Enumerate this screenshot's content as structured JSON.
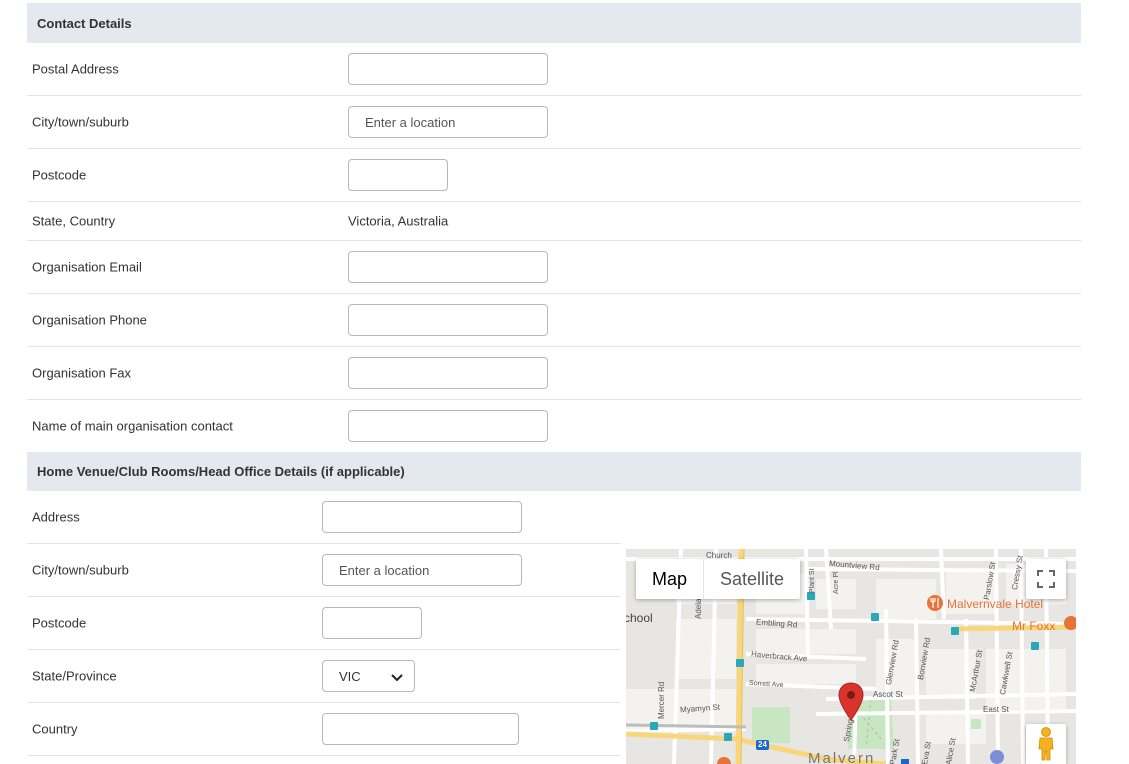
{
  "contact_section": {
    "title": "Contact Details",
    "postal_address_label": "Postal Address",
    "postal_address_value": "",
    "city_label": "City/town/suburb",
    "city_placeholder": "Enter a location",
    "postcode_label": "Postcode",
    "postcode_value": "",
    "state_country_label": "State, Country",
    "state_country_value": "Victoria, Australia",
    "email_label": "Organisation Email",
    "email_value": "",
    "phone_label": "Organisation Phone",
    "phone_value": "",
    "fax_label": "Organisation Fax",
    "fax_value": "",
    "main_contact_label": "Name of main organisation contact",
    "main_contact_value": ""
  },
  "venue_section": {
    "title": "Home Venue/Club Rooms/Head Office Details (if applicable)",
    "address_label": "Address",
    "address_value": "",
    "city_label": "City/town/suburb",
    "city_placeholder": "Enter a location",
    "postcode_label": "Postcode",
    "postcode_value": "",
    "state_label": "State/Province",
    "state_selected": "VIC",
    "country_label": "Country",
    "country_value": ""
  },
  "map": {
    "type_map_label": "Map",
    "type_satellite_label": "Satellite",
    "icons": [
      "fullscreen-icon",
      "pegman-icon",
      "location-pin-icon",
      "restaurant-icon",
      "bus-stop-icon"
    ],
    "pin_color": "#d9342b",
    "poi_color": "#e8733a",
    "labels": {
      "mountview_rd": "Mountview Rd",
      "embling_rd": "Embling Rd",
      "haverbrack_ave": "Haverbrack Ave",
      "sorrett_ave": "Sorrett Ave",
      "myamyn_st": "Myamyn St",
      "ascot_st": "Ascot St",
      "east_st": "East St",
      "adelaide_st": "Adelaide St",
      "mercer_rd": "Mercer Rd",
      "glenview_rd": "Glenview Rd",
      "bonview_rd": "Bonview Rd",
      "mcarthur_st": "McArthur St",
      "cawkwell_st": "Cawkwell St",
      "parslow_st": "Parslow St",
      "cressy_st": "Cressy St",
      "park_st": "Park St",
      "eva_st": "Eva St",
      "alice_st": "Alice St",
      "spring": "Spring",
      "plant_st": "Plant St",
      "acre_pl": "Acre Pl",
      "church": "Church",
      "school": "chool",
      "malvern": "Malvern",
      "route_24": "24",
      "malvernvale_hotel": "Malvernvale Hotel",
      "mr_foxx": "Mr Foxx"
    }
  }
}
